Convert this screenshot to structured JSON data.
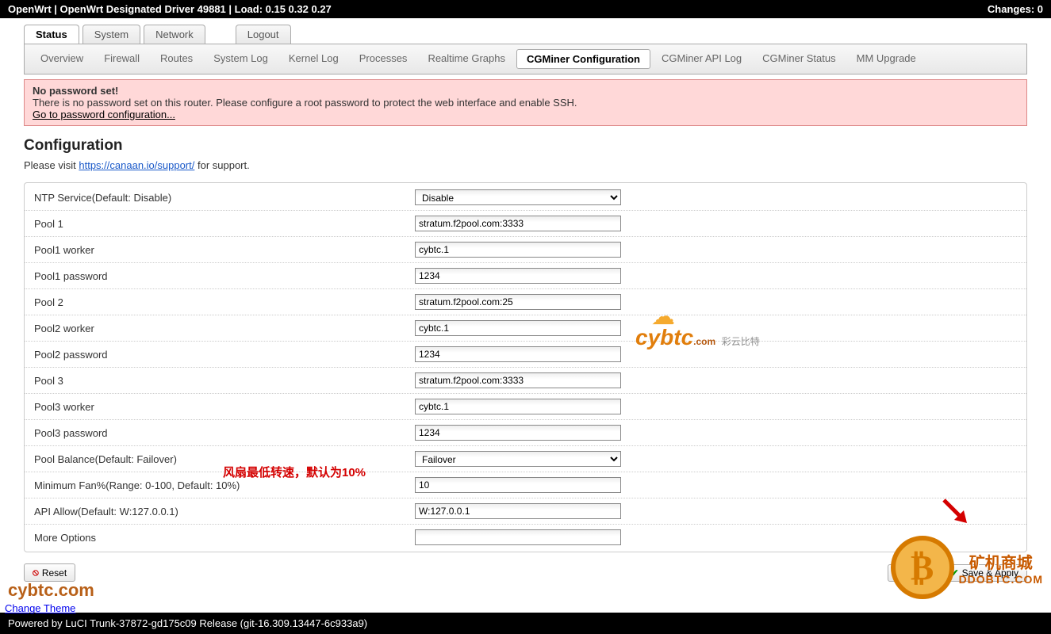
{
  "topbar": {
    "left": "OpenWrt | OpenWrt Designated Driver 49881 | Load: 0.15 0.32 0.27",
    "right": "Changes: 0"
  },
  "main_tabs": {
    "status": "Status",
    "system": "System",
    "network": "Network",
    "logout": "Logout"
  },
  "sub_tabs": {
    "overview": "Overview",
    "firewall": "Firewall",
    "routes": "Routes",
    "system_log": "System Log",
    "kernel_log": "Kernel Log",
    "processes": "Processes",
    "realtime_graphs": "Realtime Graphs",
    "cgminer_config": "CGMiner Configuration",
    "cgminer_api_log": "CGMiner API Log",
    "cgminer_status": "CGMiner Status",
    "mm_upgrade": "MM Upgrade"
  },
  "warning": {
    "title": "No password set!",
    "body": "There is no password set on this router. Please configure a root password to protect the web interface and enable SSH.",
    "link": "Go to password configuration..."
  },
  "heading": "Configuration",
  "support": {
    "prefix": "Please visit ",
    "url": "https://canaan.io/support/",
    "suffix": " for support."
  },
  "fields": {
    "ntp": {
      "label": "NTP Service(Default: Disable)",
      "value": "Disable"
    },
    "pool1": {
      "label": "Pool 1",
      "value": "stratum.f2pool.com:3333"
    },
    "pool1_worker": {
      "label": "Pool1 worker",
      "value": "cybtc.1"
    },
    "pool1_password": {
      "label": "Pool1 password",
      "value": "1234"
    },
    "pool2": {
      "label": "Pool 2",
      "value": "stratum.f2pool.com:25"
    },
    "pool2_worker": {
      "label": "Pool2 worker",
      "value": "cybtc.1"
    },
    "pool2_password": {
      "label": "Pool2 password",
      "value": "1234"
    },
    "pool3": {
      "label": "Pool 3",
      "value": "stratum.f2pool.com:3333"
    },
    "pool3_worker": {
      "label": "Pool3 worker",
      "value": "cybtc.1"
    },
    "pool3_password": {
      "label": "Pool3 password",
      "value": "1234"
    },
    "pool_balance": {
      "label": "Pool Balance(Default: Failover)",
      "value": "Failover"
    },
    "min_fan": {
      "label": "Minimum Fan%(Range: 0-100, Default: 10%)",
      "value": "10"
    },
    "api_allow": {
      "label": "API Allow(Default: W:127.0.0.1)",
      "value": "W:127.0.0.1"
    },
    "more_options": {
      "label": "More Options",
      "value": ""
    }
  },
  "annotation_fan": "风扇最低转速，默认为10%",
  "buttons": {
    "reset": "Reset",
    "save": "Save",
    "save_apply": "Save & Apply"
  },
  "footer": {
    "change_theme": "Change Theme",
    "powered": "Powered by LuCI Trunk-37872-gd175c09 Release (git-16.309.13447-6c933a9)"
  },
  "watermarks": {
    "cybtc": "cybtc",
    "cybtc_dotcom": ".com",
    "cybtc_cn": "彩云比特",
    "ddobtc_cn": "矿机商城",
    "ddobtc": "DDOBTC.COM",
    "bottom": "cybtc.com"
  }
}
